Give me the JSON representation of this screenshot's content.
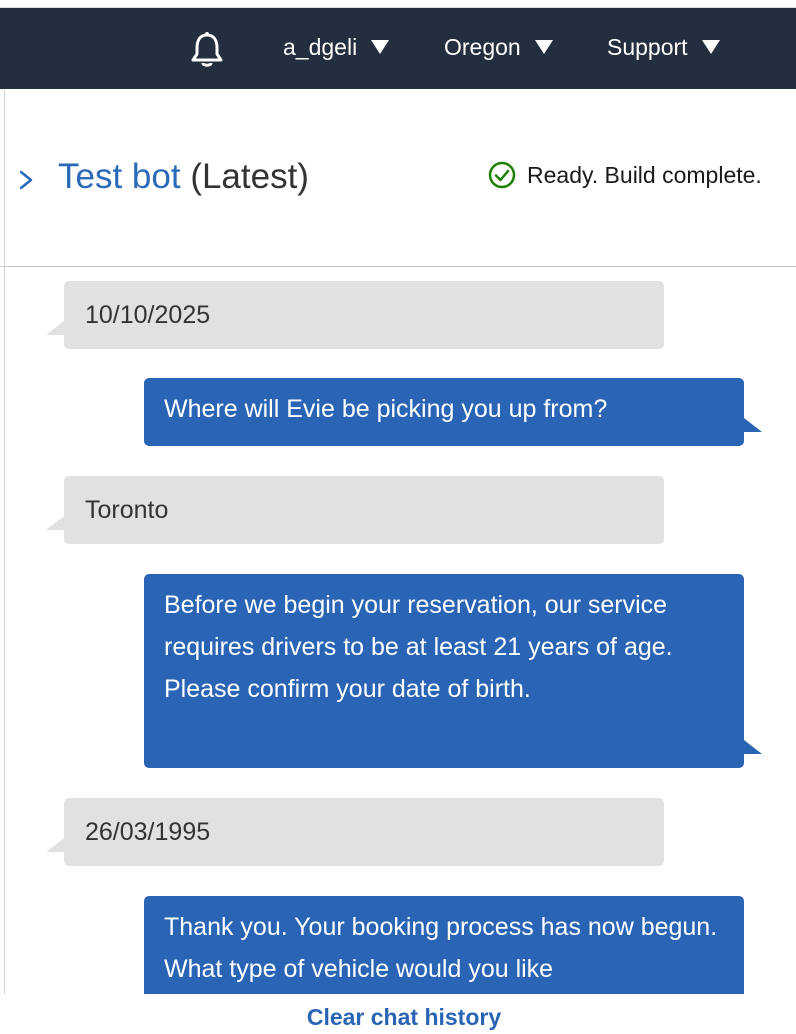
{
  "topbar": {
    "account": "a_dgeli",
    "region": "Oregon",
    "support": "Support",
    "icons": {
      "notifications": "bell-icon",
      "dropdown": "caret-down-icon"
    }
  },
  "panel": {
    "title_link": "Test bot",
    "title_suffix": "(Latest)",
    "status": "Ready. Build complete.",
    "icons": {
      "expand": "chevron-right-icon",
      "status": "check-circle-icon"
    }
  },
  "chat": {
    "messages": [
      {
        "from": "user",
        "text": "10/10/2025"
      },
      {
        "from": "bot",
        "text": "Where will Evie be picking you up from?"
      },
      {
        "from": "user",
        "text": "Toronto"
      },
      {
        "from": "bot",
        "text": "Before we begin your reservation, our service requires drivers to be at least 21 years of age. Please confirm your date of birth."
      },
      {
        "from": "user",
        "text": "26/03/1995"
      },
      {
        "from": "bot",
        "text": "Thank you. Your booking process has now begun. What type of vehicle would you like"
      }
    ],
    "clear_label": "Clear chat history"
  },
  "colors": {
    "topbar_bg": "#232f3e",
    "link": "#2a6ab8",
    "bot_bubble": "#2a65b5",
    "user_bubble": "#e1e1e1",
    "success": "#1d8102"
  }
}
